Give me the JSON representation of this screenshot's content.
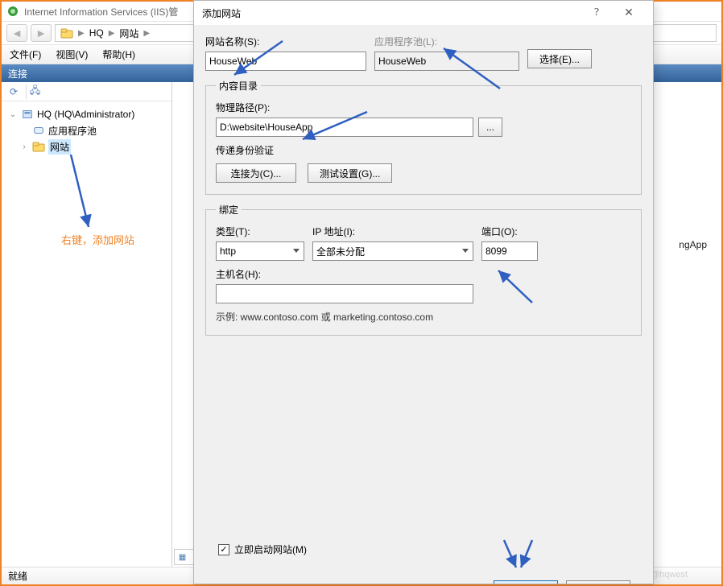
{
  "title": "Internet Information Services (IIS)管",
  "breadcrumb": {
    "root": "HQ",
    "node": "网站"
  },
  "menu": {
    "file": "文件(F)",
    "view": "视图(V)",
    "help": "帮助(H)"
  },
  "connections_header": "连接",
  "tree": {
    "server": "HQ (HQ\\Administrator)",
    "apppools": "应用程序池",
    "sites": "网站"
  },
  "content_hint_suffix": "ngApp",
  "statusbar": "就绪",
  "watermark": "CSDN @hqwest",
  "annotation_note": "右键，添加网站",
  "dialog": {
    "title": "添加网站",
    "help_glyph": "?",
    "close_glyph": "✕",
    "site_name_label": "网站名称(S):",
    "site_name_value": "HouseWeb",
    "apppool_label": "应用程序池(L):",
    "apppool_value": "HouseWeb",
    "select_btn": "选择(E)...",
    "content_group": "内容目录",
    "phys_path_label": "物理路径(P):",
    "phys_path_value": "D:\\website\\HouseApp",
    "browse_btn": "...",
    "passthrough_label": "传递身份验证",
    "connect_as_btn": "连接为(C)...",
    "test_btn": "测试设置(G)...",
    "binding_group": "绑定",
    "type_label": "类型(T):",
    "type_value": "http",
    "ip_label": "IP 地址(I):",
    "ip_value": "全部未分配",
    "port_label": "端口(O):",
    "port_value": "8099",
    "host_label": "主机名(H):",
    "host_value": "",
    "example": "示例: www.contoso.com 或 marketing.contoso.com",
    "start_now": "立即启动网站(M)"
  }
}
